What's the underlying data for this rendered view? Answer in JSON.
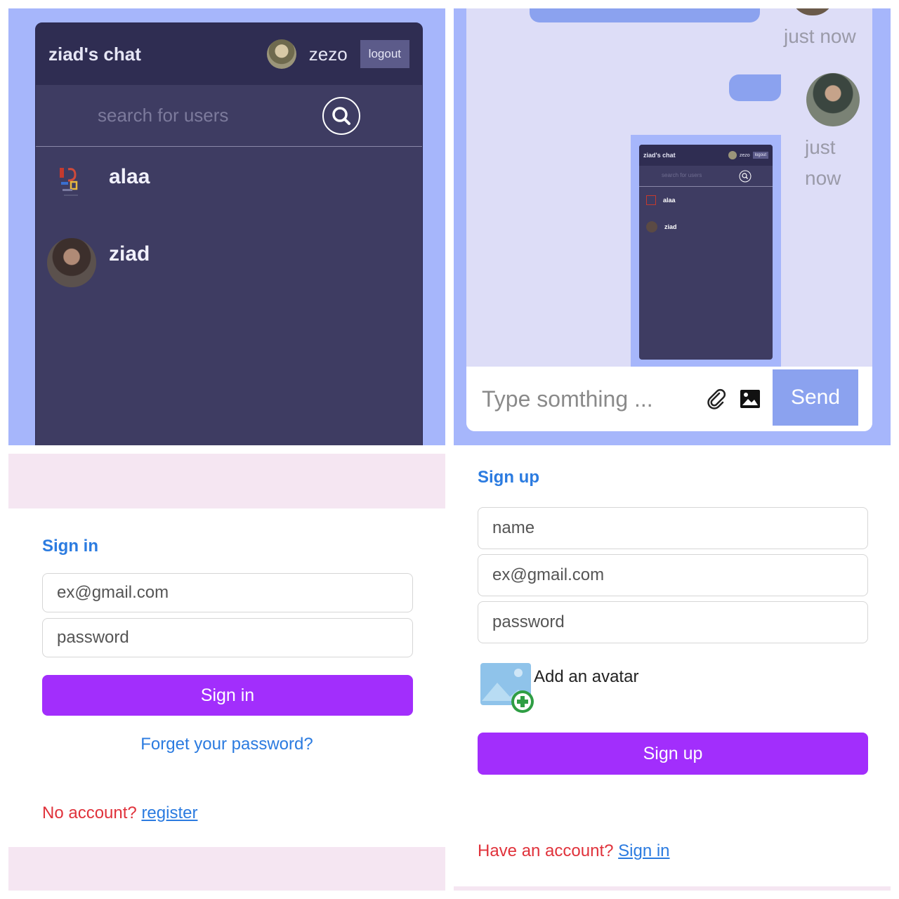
{
  "colors": {
    "panel_bg": "#a6b6fb",
    "app_dark": "#3e3c62",
    "navbar": "#2f2d52",
    "bubble": "#8ba2ef",
    "chat_bg": "#ddddf7",
    "primary_purple": "#a22efc",
    "link_blue": "#2b7be0",
    "error_red": "#e0323b",
    "pink_band": "#f5e6f2"
  },
  "sidebar": {
    "brand": "ziad's chat",
    "current_user": "zezo",
    "logout_label": "logout",
    "search_placeholder": "search for users",
    "users": [
      {
        "name": "alaa"
      },
      {
        "name": "ziad"
      }
    ]
  },
  "chat": {
    "messages": [
      {
        "time": "just now"
      },
      {
        "time": "just now"
      }
    ],
    "mini_preview": {
      "brand": "ziad's chat",
      "current_user": "zezo",
      "logout_label": "logout",
      "search_placeholder": "search for users",
      "users": [
        "alaa",
        "ziad"
      ]
    },
    "input_placeholder": "Type somthing ...",
    "send_label": "Send"
  },
  "signin": {
    "title": "Sign in",
    "email_placeholder": "ex@gmail.com",
    "password_placeholder": "password",
    "button_label": "Sign in",
    "forgot_label": "Forget your password?",
    "no_account_text": "No account?",
    "register_label": "register"
  },
  "signup": {
    "title": "Sign up",
    "name_placeholder": "name",
    "email_placeholder": "ex@gmail.com",
    "password_placeholder": "password",
    "avatar_label": "Add an avatar",
    "button_label": "Sign up",
    "have_account_text": "Have an account?",
    "signin_label": "Sign in"
  }
}
